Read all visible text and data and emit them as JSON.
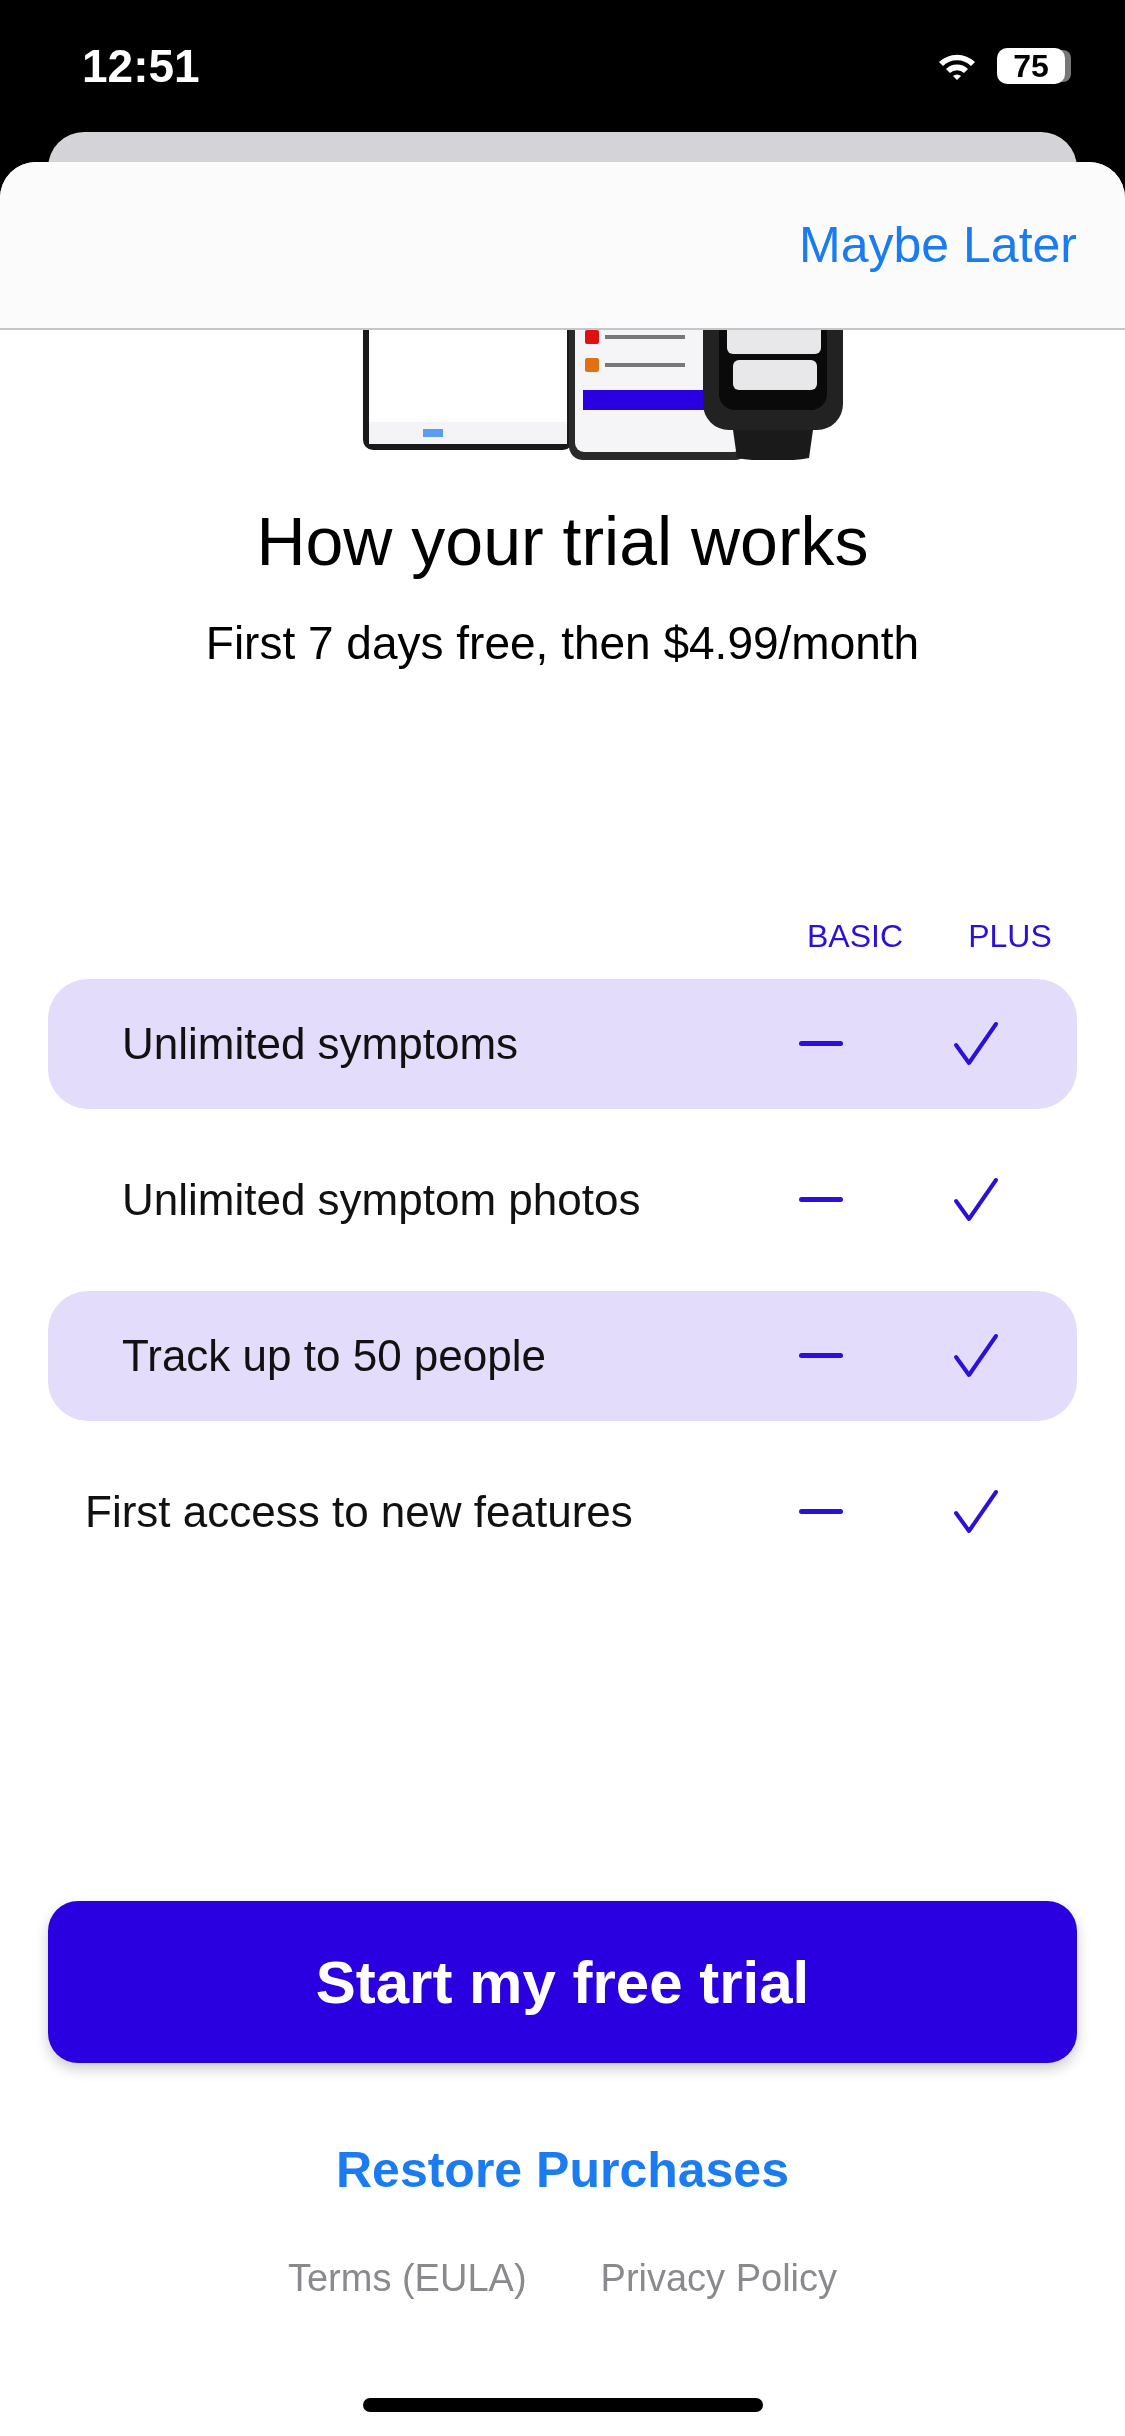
{
  "status_bar": {
    "time": "12:51",
    "battery": "75"
  },
  "header": {
    "action": "Maybe Later"
  },
  "title": "How your trial works",
  "subtitle": "First 7 days free, then $4.99/month",
  "plans": [
    "BASIC",
    "PLUS"
  ],
  "features": [
    {
      "label": "Unlimited symptoms",
      "highlighted": true,
      "basic": false,
      "plus": true
    },
    {
      "label": "Unlimited symptom photos",
      "highlighted": false,
      "basic": false,
      "plus": true
    },
    {
      "label": "Track up to 50 people",
      "highlighted": true,
      "basic": false,
      "plus": true
    },
    {
      "label": "First access to new features",
      "highlighted": false,
      "basic": false,
      "plus": true
    }
  ],
  "cta": "Start my free trial",
  "restore": "Restore Purchases",
  "footer_links": [
    "Terms (EULA)",
    "Privacy Policy"
  ]
}
